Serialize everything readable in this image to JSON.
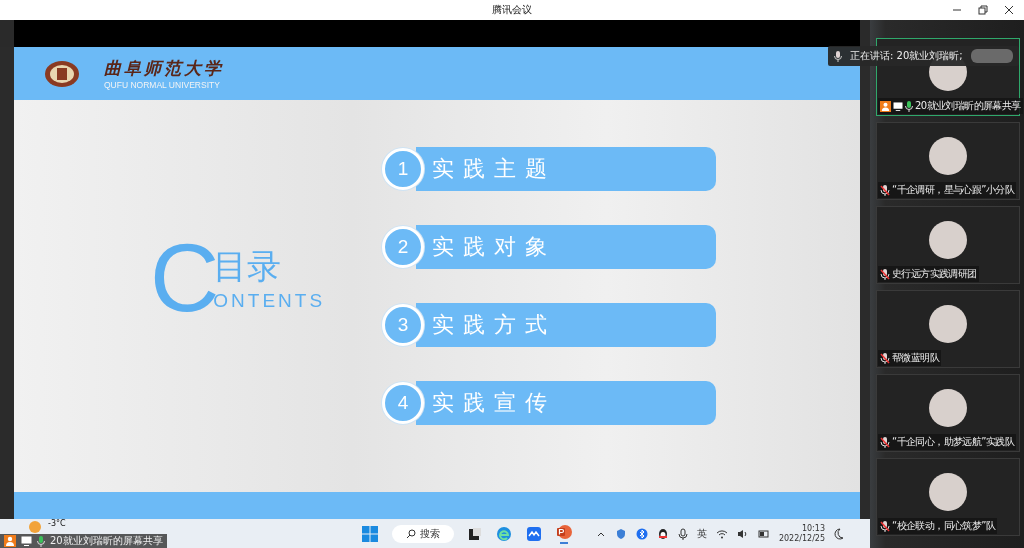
{
  "window": {
    "title": "腾讯会议"
  },
  "speaking_banner": {
    "label": "正在讲话: 20就业刘瑞昕;"
  },
  "slide": {
    "school_name": "曲阜师范大学",
    "school_name_en": "QUFU NORMAL UNIVERSITY",
    "heading_letter": "C",
    "heading_cn": "目录",
    "heading_rest": "ONTENTS",
    "items": [
      {
        "number": "1",
        "label": "实践主题"
      },
      {
        "number": "2",
        "label": "实践对象"
      },
      {
        "number": "3",
        "label": "实践方式"
      },
      {
        "number": "4",
        "label": "实践宣传"
      }
    ]
  },
  "participants": [
    {
      "name": "20就业刘瑞昕的屏幕共享",
      "muted": false,
      "active": true
    },
    {
      "name": "“千企调研，星与心跟”小分队",
      "muted": true,
      "active": false
    },
    {
      "name": "史行远方实践调研团",
      "muted": true,
      "active": false
    },
    {
      "name": "帮微蓝明队",
      "muted": true,
      "active": false
    },
    {
      "name": "“千企同心，助梦远航”实践队",
      "muted": true,
      "active": false
    },
    {
      "name": "“校企联动，同心筑梦”队",
      "muted": true,
      "active": false
    }
  ],
  "share_indicator": {
    "label": "20就业刘瑞昕的屏幕共享"
  },
  "taskbar": {
    "weather": "-3°C",
    "search": "搜索",
    "input_method": "英",
    "time": "10:13",
    "date": "2022/12/25"
  }
}
